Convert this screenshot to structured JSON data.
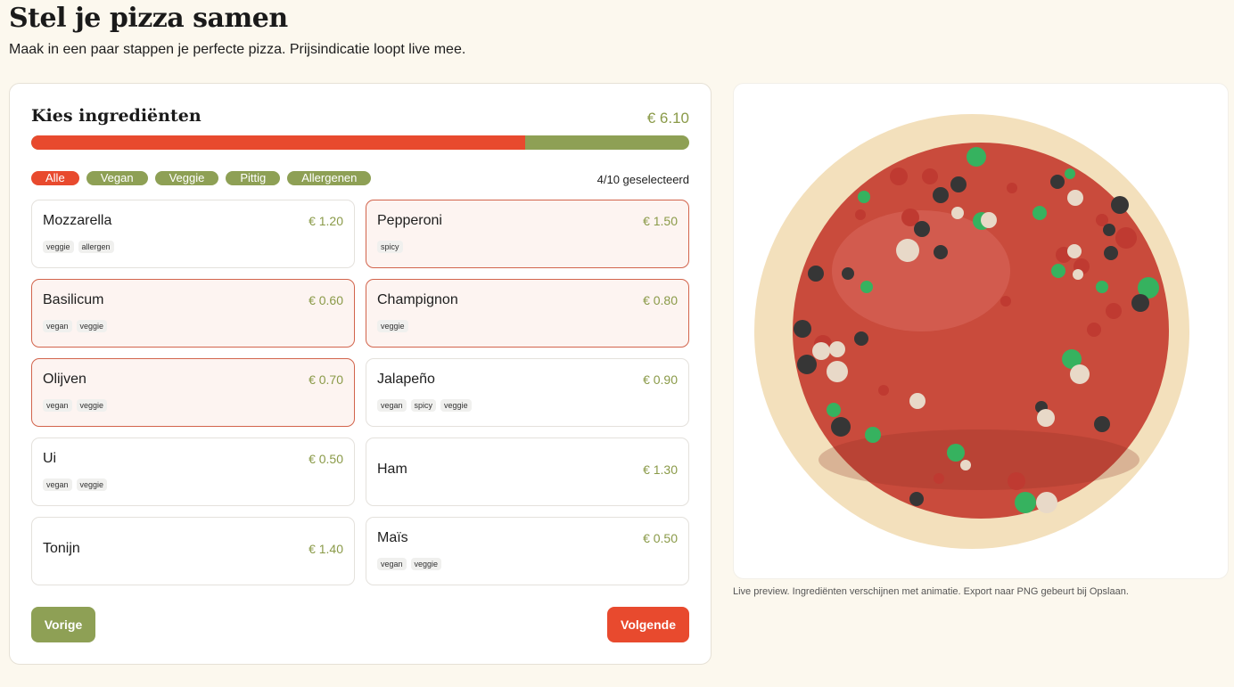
{
  "header": {
    "title": "Stel je pizza samen",
    "subtitle": "Maak in een paar stappen je perfecte pizza. Prijsindicatie loopt live mee."
  },
  "builder": {
    "title": "Kies ingrediënten",
    "total_price": "€ 6.10",
    "progress_fraction": 0.75,
    "filters": [
      {
        "label": "Alle",
        "active": true
      },
      {
        "label": "Vegan",
        "active": false
      },
      {
        "label": "Veggie",
        "active": false
      },
      {
        "label": "Pittig",
        "active": false
      },
      {
        "label": "Allergenen",
        "active": false
      }
    ],
    "selected_count": "4/10 geselecteerd",
    "ingredients": [
      {
        "name": "Mozzarella",
        "price": "€ 1.20",
        "tags": [
          "veggie",
          "allergen"
        ],
        "selected": false
      },
      {
        "name": "Pepperoni",
        "price": "€ 1.50",
        "tags": [
          "spicy"
        ],
        "selected": true
      },
      {
        "name": "Basilicum",
        "price": "€ 0.60",
        "tags": [
          "vegan",
          "veggie"
        ],
        "selected": true
      },
      {
        "name": "Champignon",
        "price": "€ 0.80",
        "tags": [
          "veggie"
        ],
        "selected": true
      },
      {
        "name": "Olijven",
        "price": "€ 0.70",
        "tags": [
          "vegan",
          "veggie"
        ],
        "selected": true
      },
      {
        "name": "Jalapeño",
        "price": "€ 0.90",
        "tags": [
          "vegan",
          "spicy",
          "veggie"
        ],
        "selected": false
      },
      {
        "name": "Ui",
        "price": "€ 0.50",
        "tags": [
          "vegan",
          "veggie"
        ],
        "selected": false
      },
      {
        "name": "Ham",
        "price": "€ 1.30",
        "tags": [],
        "selected": false
      },
      {
        "name": "Tonijn",
        "price": "€ 1.40",
        "tags": [],
        "selected": false
      },
      {
        "name": "Maïs",
        "price": "€ 0.50",
        "tags": [
          "vegan",
          "veggie"
        ],
        "selected": false
      }
    ],
    "prev_label": "Vorige",
    "next_label": "Volgende"
  },
  "preview": {
    "caption": "Live preview. Ingrediënten verschijnen met animatie. Export naar PNG gebeurt bij Opslaan.",
    "toppings": [
      "pepperoni",
      "basil",
      "mushroom",
      "olive"
    ]
  },
  "colors": {
    "accent_red": "#e84a2e",
    "accent_green": "#8ea055",
    "price_green": "#8a9a48",
    "crust": "#f3e0bc",
    "sauce": "#c94b3c",
    "cheese_highlight": "#d86a5c",
    "pepperoni": "#bf3a31",
    "basil": "#36b25f",
    "olive": "#363636",
    "mushroom": "#e8d9c8"
  }
}
